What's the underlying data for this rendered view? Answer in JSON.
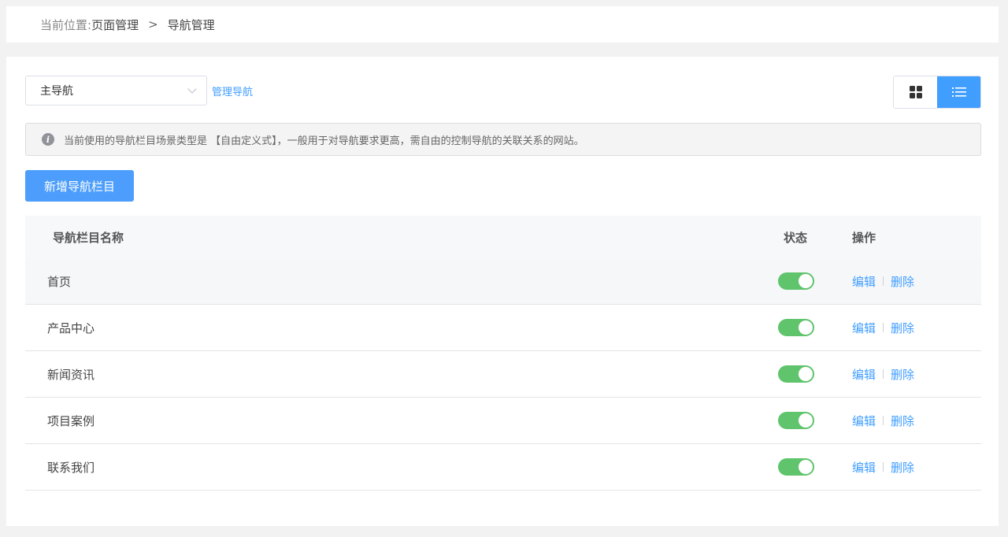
{
  "breadcrumb": {
    "prefix": "当前位置:",
    "items": [
      "页面管理",
      "导航管理"
    ],
    "separator": ">"
  },
  "nav_select": {
    "value": "主导航"
  },
  "manage_link": "管理导航",
  "view_toggle": {
    "active": "list",
    "grid_icon": "grid-icon",
    "list_icon": "list-icon"
  },
  "notice": {
    "icon": "info-icon",
    "text": "当前使用的导航栏目场景类型是 【自由定义式】，一般用于对导航要求更高，需自由的控制导航的关联关系的网站。"
  },
  "add_button": "新增导航栏目",
  "table": {
    "headers": {
      "name": "导航栏目名称",
      "status": "状态",
      "ops": "操作"
    },
    "rows": [
      {
        "name": "首页",
        "enabled": true,
        "edit": "编辑",
        "delete": "删除"
      },
      {
        "name": "产品中心",
        "enabled": true,
        "edit": "编辑",
        "delete": "删除"
      },
      {
        "name": "新闻资讯",
        "enabled": true,
        "edit": "编辑",
        "delete": "删除"
      },
      {
        "name": "项目案例",
        "enabled": true,
        "edit": "编辑",
        "delete": "删除"
      },
      {
        "name": "联系我们",
        "enabled": true,
        "edit": "编辑",
        "delete": "删除"
      }
    ]
  },
  "colors": {
    "primary": "#409eff",
    "switch_on": "#5fc46c"
  }
}
